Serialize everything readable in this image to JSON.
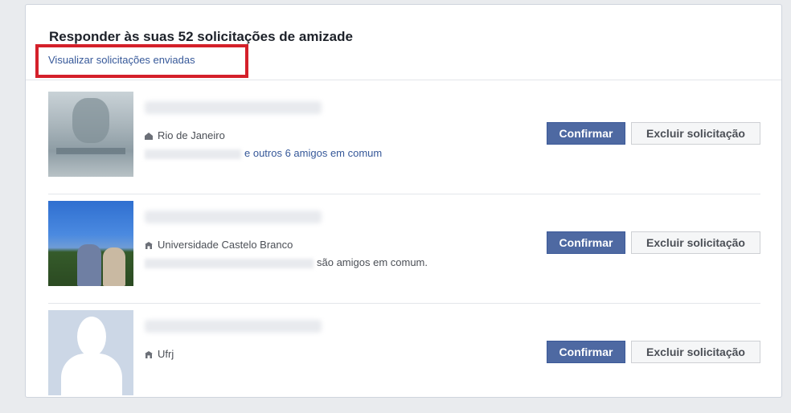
{
  "header": {
    "title": "Responder às suas 52 solicitações de amizade",
    "sent_requests_link": "Visualizar solicitações enviadas"
  },
  "requests": [
    {
      "location": "Rio de Janeiro",
      "location_icon": "home-icon",
      "mutual_link": "e outros 6 amigos em comum",
      "confirm_label": "Confirmar",
      "delete_label": "Excluir solicitação"
    },
    {
      "location": "Universidade Castelo Branco",
      "location_icon": "school-icon",
      "mutual_text": "são amigos em comum.",
      "confirm_label": "Confirmar",
      "delete_label": "Excluir solicitação"
    },
    {
      "location": "Ufrj",
      "location_icon": "school-icon",
      "confirm_label": "Confirmar",
      "delete_label": "Excluir solicitação"
    }
  ],
  "colors": {
    "accent": "#4e69a2",
    "link": "#365899",
    "highlight": "#d4202a"
  }
}
